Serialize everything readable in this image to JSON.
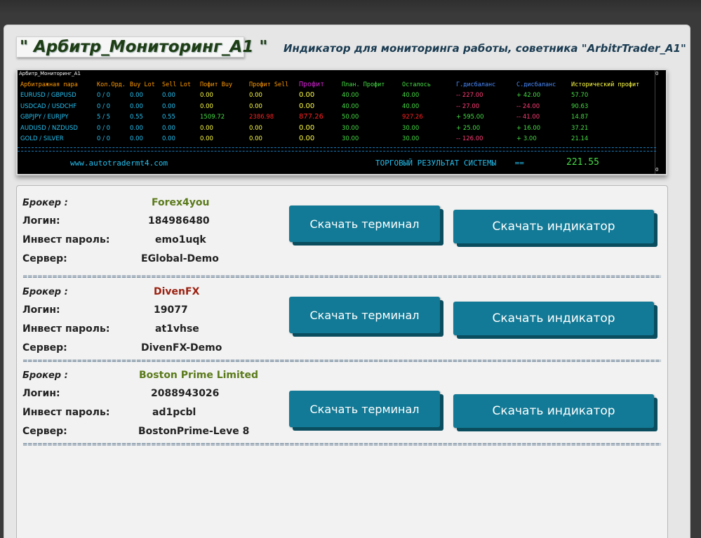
{
  "header": {
    "title": "\" Арбитр_Мониторинг_A1 \"",
    "subtitle": "Индикатор для мониторинга работы, советника \"ArbitrTrader_A1\""
  },
  "monitor": {
    "title": "Арбитр_Мониторинг_A1",
    "zero_top": "0",
    "zero_bottom": "0",
    "columns": [
      "Арбитражная пара",
      "Кол.Орд.",
      "Buy Lot",
      "Sell Lot",
      "Пофит Buy",
      "Профит Sell",
      "Профит",
      "План. Профит",
      "Осталось",
      "Г.дисбаланс",
      "С.дисбаланс",
      "Исторический профит"
    ],
    "rows": [
      [
        "EURUSD / GBPUSD",
        "0 / 0",
        "0.00",
        "0.00",
        "0.00",
        "0.00",
        "0.00",
        "40.00",
        "40.00",
        "-- 227.00",
        "+ 42.00",
        "57.70"
      ],
      [
        "USDCAD / USDCHF",
        "0 / 0",
        "0.00",
        "0.00",
        "0.00",
        "0.00",
        "0.00",
        "40.00",
        "40.00",
        "-- 27.00",
        "-- 24.00",
        "90.63"
      ],
      [
        "GBPJPY / EURJPY",
        "5 / 5",
        "0.55",
        "0.55",
        "1509.72",
        "2386.98",
        "877.26",
        "50.00",
        "927.26",
        "+ 595.00",
        "-- 41.00",
        "14.87"
      ],
      [
        "AUDUSD / NZDUSD",
        "0 / 0",
        "0.00",
        "0.00",
        "0.00",
        "0.00",
        "0.00",
        "30.00",
        "30.00",
        "+ 25.00",
        "+ 16.00",
        "37.21"
      ],
      [
        "GOLD / SILVER",
        "0 / 0",
        "0.00",
        "0.00",
        "0.00",
        "0.00",
        "0.00",
        "30.00",
        "30.00",
        "-- 126.00",
        "+ 3.00",
        "21.14"
      ]
    ],
    "separator": "+=========================================================================================================================================================+",
    "url": "www.autotradermt4.com",
    "result_label": "ТОРГОВЫЙ РЕЗУЛЬТАТ СИСТЕМЫ    ==",
    "result_value": "221.55",
    "colors": {
      "header_orange": "#ff9a00",
      "profit_magenta": "#d020d0",
      "header_green": "#44dd44",
      "header_blue": "#4a8cff",
      "header_yellow": "#ffff44",
      "cyan": "#24c0f0",
      "red": "#ff2020",
      "pink": "#ff3c78"
    }
  },
  "brokers": [
    {
      "broker_label": "Брокер :",
      "broker_name": "Forex4you",
      "broker_color": "#5a7a1a",
      "login_label": "Логин:",
      "login": "184986480",
      "password_label": "Инвест пароль:",
      "password": "emo1uqk",
      "server_label": "Сервер:",
      "server": "EGlobal-Demo",
      "terminal_button": "Скачать терминал",
      "indicator_button": "Скачать индикатор"
    },
    {
      "broker_label": "Брокер :",
      "broker_name": "DivenFX",
      "broker_color": "#9a2010",
      "login_label": "Логин:",
      "login": "19077",
      "password_label": "Инвест пароль:",
      "password": "at1vhse",
      "server_label": "Сервер:",
      "server": "DivenFX-Demo",
      "terminal_button": "Скачать терминал",
      "indicator_button": "Скачать индикатор"
    },
    {
      "broker_label": "Брокер :",
      "broker_name": "Boston Prime Limited",
      "broker_color": "#5a7a1a",
      "login_label": "Логин:",
      "login": "2088943026",
      "password_label": "Инвест пароль:",
      "password": "ad1pcbl",
      "server_label": "Сервер:",
      "server": "BostonPrime-Leve 8",
      "terminal_button": "Скачать терминал",
      "indicator_button": "Скачать индикатор"
    }
  ],
  "divider": "==================================================================================================================================================================================="
}
